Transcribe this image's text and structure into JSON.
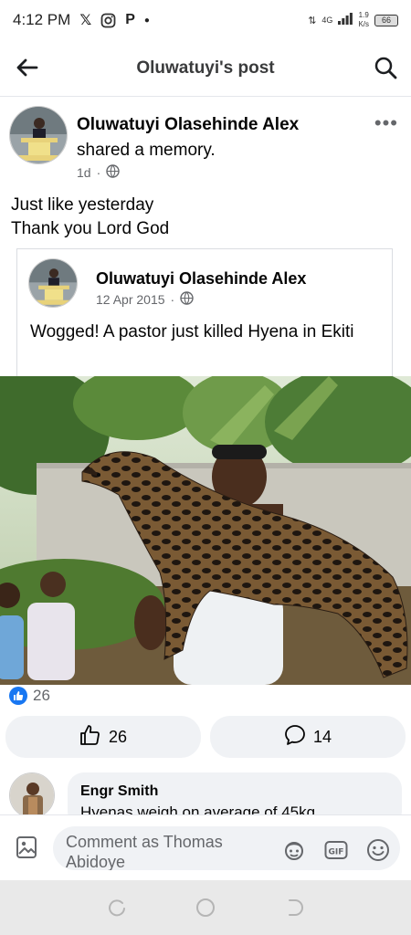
{
  "status_bar": {
    "time": "4:12 PM",
    "network": "4G",
    "speed_value": "1.9",
    "speed_unit": "K/s",
    "battery": "66"
  },
  "header": {
    "title": "Oluwatuyi's post"
  },
  "post": {
    "author": "Oluwatuyi Olasehinde Alex",
    "action": "shared a memory.",
    "time": "1d",
    "separator": "·",
    "more_label": "•••",
    "text_lines": [
      "Just like yesterday",
      "Thank you Lord God"
    ]
  },
  "shared_post": {
    "author": "Oluwatuyi Olasehinde Alex",
    "date": "12 Apr 2015",
    "separator": "·",
    "text": "Wogged! A pastor just killed Hyena in Ekiti"
  },
  "reactions": {
    "count": "26"
  },
  "actions": {
    "like_count": "26",
    "comment_count": "14"
  },
  "comment_preview": {
    "author": "Engr Smith",
    "text": "Hyenas weigh on average of 45kg"
  },
  "composer": {
    "placeholder": "Comment as Thomas Abidoye"
  },
  "colors": {
    "accent": "#1877f2",
    "secondary_text": "#65676b",
    "surface": "#f0f2f5"
  }
}
